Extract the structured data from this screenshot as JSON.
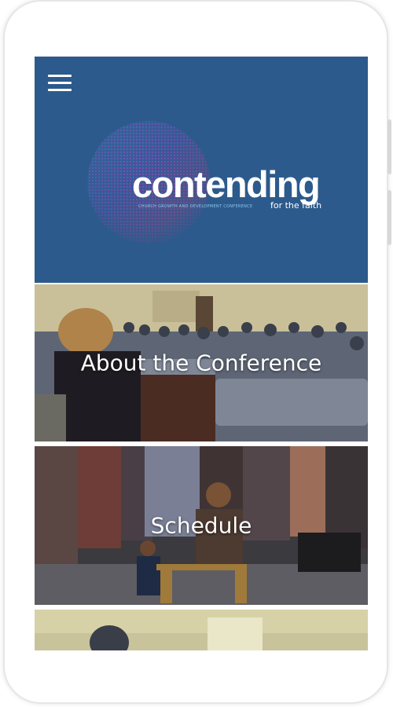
{
  "header": {
    "menu_icon": "hamburger-menu-icon",
    "logo": {
      "word": "contending",
      "tagline": "CHURCH GROWTH AND DEVELOPMENT CONFERENCE",
      "sub": "for the faith"
    }
  },
  "cards": [
    {
      "label": "About the Conference"
    },
    {
      "label": "Schedule"
    },
    {
      "label": ""
    }
  ],
  "colors": {
    "header_bg": "#2d5a8c",
    "text": "#ffffff"
  }
}
